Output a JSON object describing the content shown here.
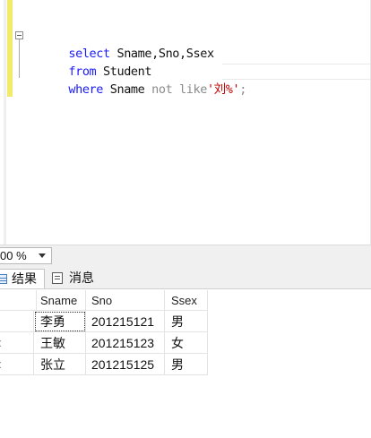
{
  "editor": {
    "lines": [
      {
        "kw": "select",
        "rest": " Sname,Sno,Ssex"
      },
      {
        "kw": "from",
        "rest": " Student"
      },
      {
        "kw": "where",
        "rest": " Sname ",
        "op": "not like",
        "str": "'刘%'",
        "end": ";"
      }
    ]
  },
  "zoom": {
    "value": "00 %"
  },
  "tabs": {
    "results": "结果",
    "messages": "消息"
  },
  "results": {
    "columns": [
      "Sname",
      "Sno",
      "Ssex"
    ],
    "rows": [
      {
        "rownum": "",
        "cells": [
          "李勇",
          "201215121",
          "男"
        ]
      },
      {
        "rownum": ":",
        "cells": [
          "王敏",
          "201215123",
          "女"
        ]
      },
      {
        "rownum": ":",
        "cells": [
          "张立",
          "201215125",
          "男"
        ]
      }
    ]
  }
}
